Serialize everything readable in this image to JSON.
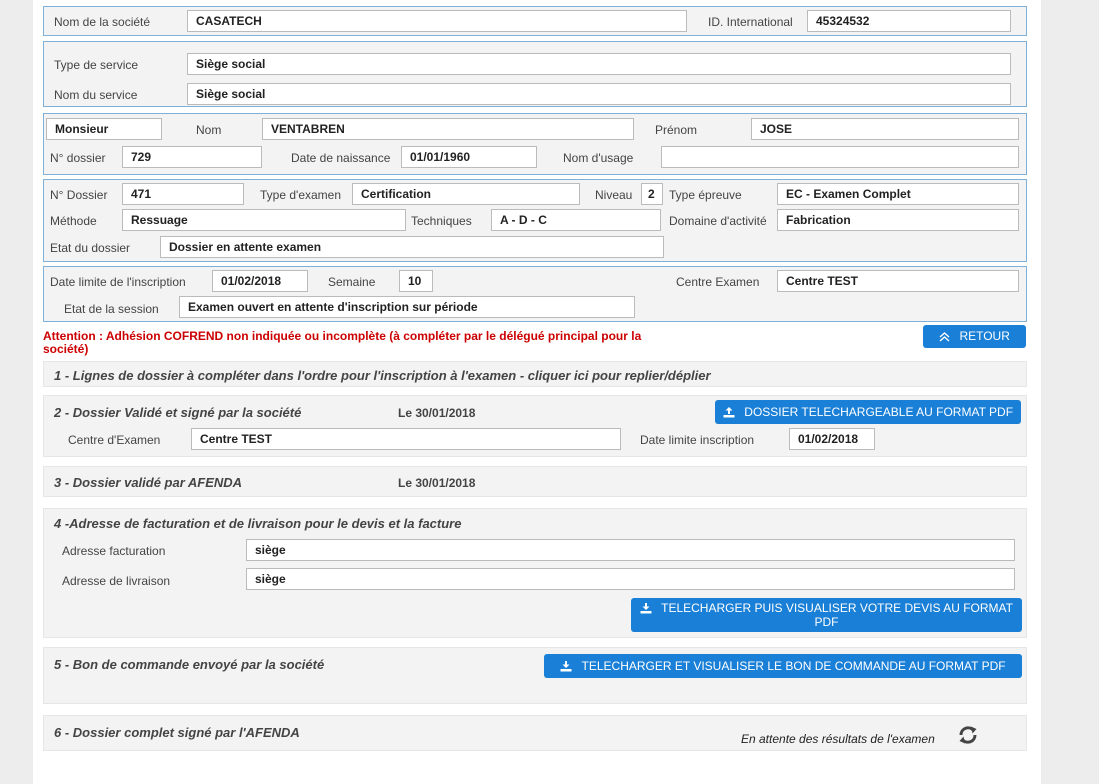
{
  "company": {
    "name_label": "Nom de la société",
    "name_value": "CASATECH",
    "intl_label": "ID. International",
    "intl_value": "45324532"
  },
  "service": {
    "type_label": "Type de service",
    "type_value": "Siège social",
    "name_label": "Nom du service",
    "name_value": "Siège social"
  },
  "person": {
    "civility": "Monsieur",
    "nom_label": "Nom",
    "nom_value": "VENTABREN",
    "prenom_label": "Prénom",
    "prenom_value": "JOSE",
    "dossier_label": "N° dossier",
    "dossier_value": "729",
    "birth_label": "Date de naissance",
    "birth_value": "01/01/1960",
    "usage_label": "Nom d'usage",
    "usage_value": ""
  },
  "exam": {
    "dossier_label": "N° Dossier",
    "dossier_value": "471",
    "type_label": "Type d'examen",
    "type_value": "Certification",
    "niveau_label": "Niveau",
    "niveau_value": "2",
    "epreuve_label": "Type épreuve",
    "epreuve_value": "EC - Examen Complet",
    "methode_label": "Méthode",
    "methode_value": "Ressuage",
    "tech_label": "Techniques",
    "tech_value": "A - D - C",
    "domaine_label": "Domaine d'activité",
    "domaine_value": "Fabrication",
    "etat_label": "Etat du dossier",
    "etat_value": "Dossier en attente examen"
  },
  "session": {
    "limit_label": "Date limite de l'inscription",
    "limit_value": "01/02/2018",
    "week_label": "Semaine",
    "week_value": "10",
    "centre_label": "Centre Examen",
    "centre_value": "Centre TEST",
    "etat_label": "Etat de la session",
    "etat_value": "Examen ouvert en attente d'inscription sur période"
  },
  "warning": "Attention : Adhésion COFREND non indiquée ou incomplète (à compléter par le délégué principal pour la société)",
  "retour_label": "RETOUR",
  "steps": {
    "s1_title": "1 - Lignes de dossier à compléter dans l'ordre pour l'inscription à l'examen - cliquer ici pour replier/déplier",
    "s2_title": "2 - Dossier Validé et signé par la société",
    "s2_date": "Le  30/01/2018",
    "s2_button": "DOSSIER TELECHARGEABLE AU FORMAT PDF",
    "s2_centre_label": "Centre d'Examen",
    "s2_centre_value": "Centre TEST",
    "s2_limit_label": "Date limite inscription",
    "s2_limit_value": "01/02/2018",
    "s3_title": "3 - Dossier validé par AFENDA",
    "s3_date": "Le  30/01/2018",
    "s4_title": "4 -Adresse de facturation et de livraison pour le devis et la facture",
    "s4_fact_label": "Adresse facturation",
    "s4_fact_value": "siège",
    "s4_liv_label": "Adresse de livraison",
    "s4_liv_value": "siège",
    "s4_button_l1": "TELECHARGER PUIS VISUALISER VOTRE DEVIS AU FORMAT",
    "s4_button_l2": "PDF",
    "s5_title": "5 - Bon de commande envoyé par la société",
    "s5_button": "TELECHARGER ET VISUALISER LE BON DE COMMANDE AU FORMAT PDF",
    "s6_title": "6 - Dossier complet signé par l'AFENDA",
    "s6_status": "En attente des résultats de l'examen"
  },
  "icons": {
    "retour": "double-chevron-up-icon",
    "upload": "upload-icon",
    "download": "download-icon",
    "refresh": "refresh-icon"
  },
  "colors": {
    "accent": "#1a7fd6",
    "warning": "#cc0000",
    "border": "#7fb0d8"
  }
}
